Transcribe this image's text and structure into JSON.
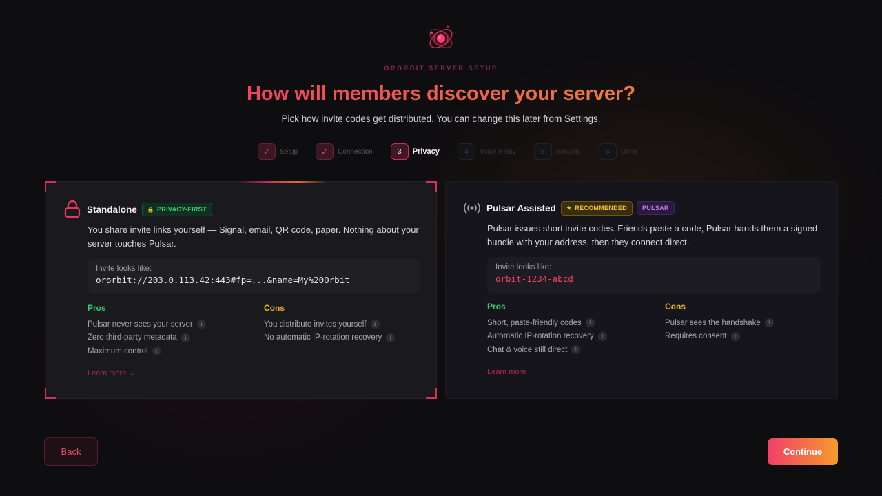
{
  "brand": "ORORBIT SERVER SETUP",
  "title": "How will members discover your server?",
  "subtitle": "Pick how invite codes get distributed. You can change this later from Settings.",
  "steps": [
    {
      "marker": "✓",
      "label": "Setup",
      "state": "done"
    },
    {
      "marker": "✓",
      "label": "Connection",
      "state": "done"
    },
    {
      "marker": "3",
      "label": "Privacy",
      "state": "active"
    },
    {
      "marker": "4",
      "label": "Voice Relay",
      "state": "todo"
    },
    {
      "marker": "5",
      "label": "Security",
      "state": "todo"
    },
    {
      "marker": "6",
      "label": "Done",
      "state": "todo"
    }
  ],
  "standalone": {
    "title": "Standalone",
    "badge": "PRIVACY-FIRST",
    "badge_icon": "lock-icon",
    "icon": "lock-icon",
    "selected": true,
    "description": "You share invite links yourself — Signal, email, QR code, paper. Nothing about your server touches Pulsar.",
    "invite_label": "Invite looks like:",
    "invite_value": "ororbit://203.0.113.42:443#fp=...&name=My%20Orbit",
    "pros_label": "Pros",
    "pros": [
      "Pulsar never sees your server",
      "Zero third-party metadata",
      "Maximum control"
    ],
    "cons_label": "Cons",
    "cons": [
      "You distribute invites yourself",
      "No automatic IP-rotation recovery"
    ],
    "learn_more": "Learn more →"
  },
  "pulsar": {
    "title": "Pulsar Assisted",
    "badge": "RECOMMENDED",
    "badge_icon": "star-icon",
    "badge2": "PULSAR",
    "icon": "broadcast-icon",
    "selected": false,
    "description": "Pulsar issues short invite codes. Friends paste a code, Pulsar hands them a signed bundle with your address, then they connect direct.",
    "invite_label": "Invite looks like:",
    "invite_value": "orbit-1234-abcd",
    "pros_label": "Pros",
    "pros": [
      "Short, paste-friendly codes",
      "Automatic IP-rotation recovery",
      "Chat & voice still direct"
    ],
    "cons_label": "Cons",
    "cons": [
      "Pulsar sees the handshake",
      "Requires consent"
    ],
    "learn_more": "Learn more →"
  },
  "info_glyph": "i",
  "buttons": {
    "back": "Back",
    "continue": "Continue"
  },
  "colors": {
    "accent": "#e8375f",
    "accent_orange": "#f69a2a",
    "pros": "#38c777",
    "cons": "#e6b32a"
  }
}
